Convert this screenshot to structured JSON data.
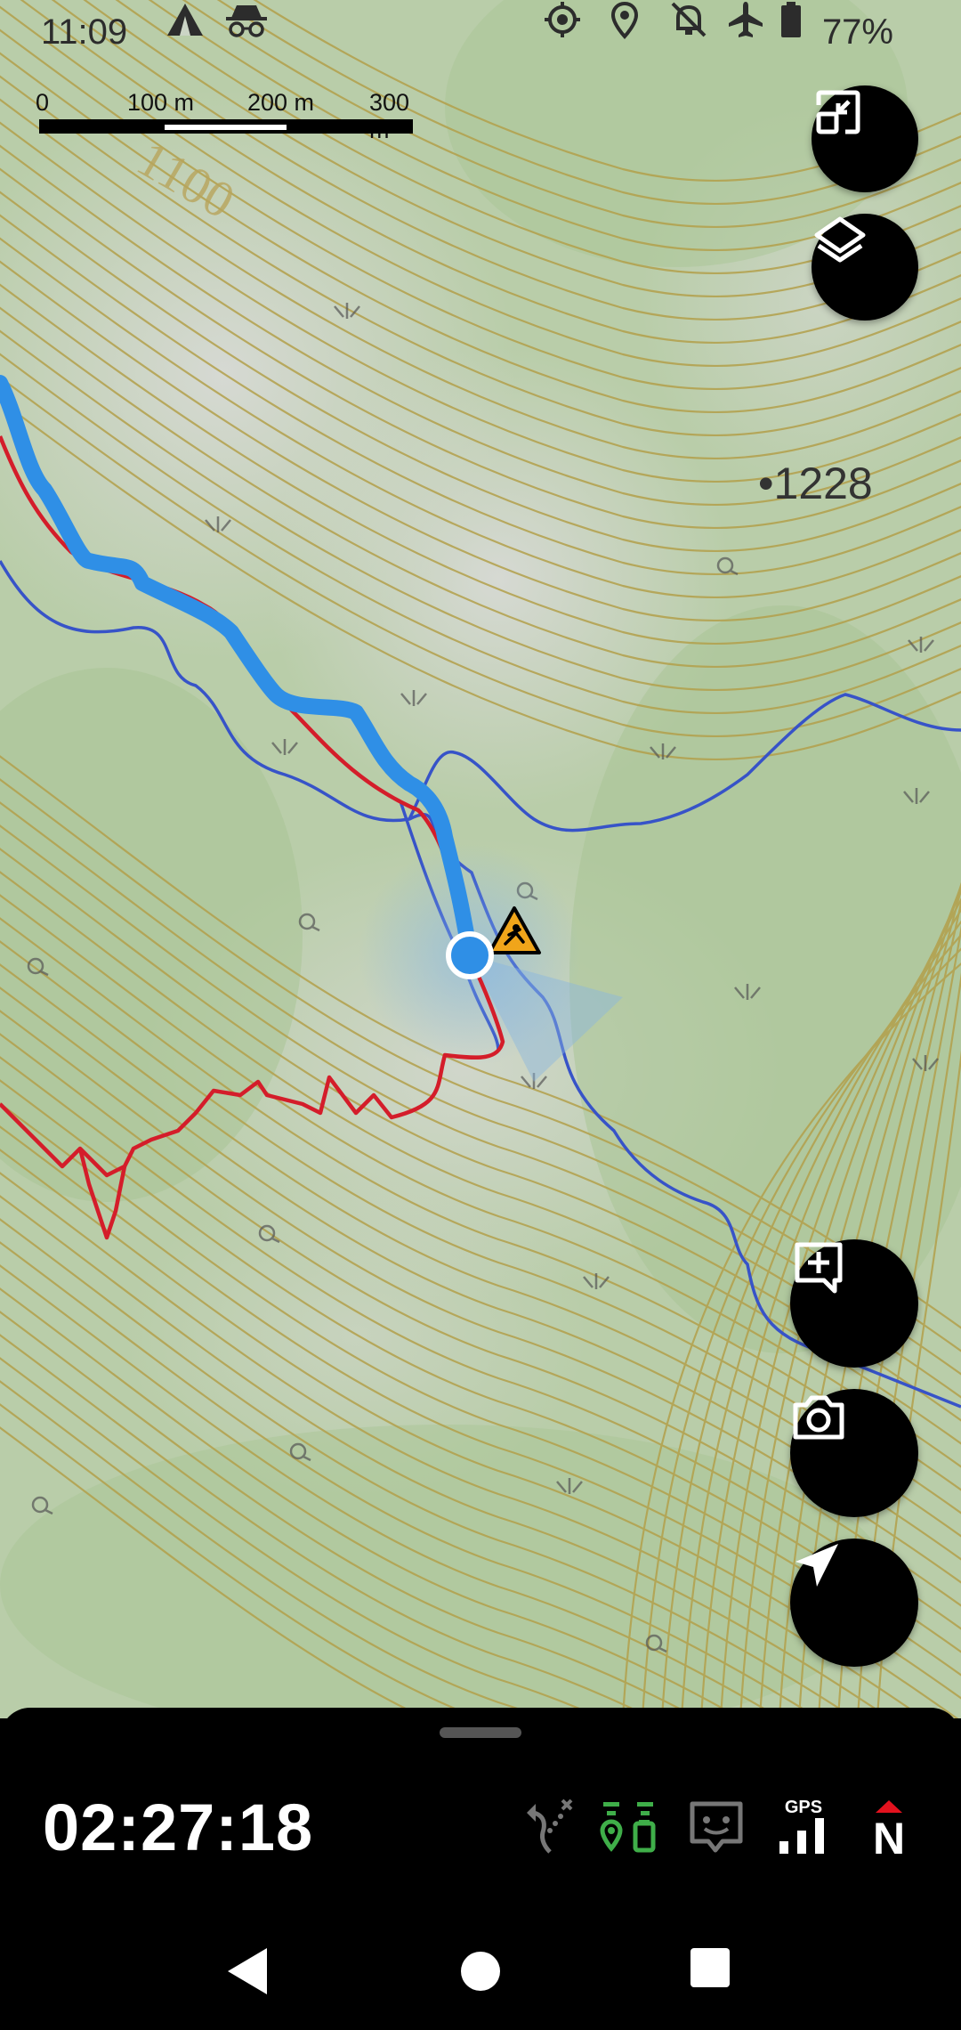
{
  "status_bar": {
    "time": "11:09",
    "battery": "77%",
    "icons": [
      "tent-icon",
      "incognito-icon",
      "gps-target-icon",
      "location-pin-icon",
      "notifications-off-icon",
      "airplane-mode-icon",
      "battery-icon"
    ]
  },
  "scale_bar": {
    "labels": [
      "0",
      "100 m",
      "200 m",
      "300 m"
    ]
  },
  "map": {
    "elevation_labels": [
      "1100",
      "•1228"
    ],
    "markers": [
      "current-location-dot",
      "fall-hazard-warning-icon"
    ],
    "colors": {
      "track": "#2f8fe6",
      "trail": "#d41d2a",
      "stream": "#3753c8",
      "contour": "#b3a04b",
      "terrain_light": "#cfd6c9",
      "terrain_green": "#a9c596"
    }
  },
  "fabs": [
    "fit-screen-icon",
    "layers-icon",
    "add-note-icon",
    "camera-icon",
    "navigate-icon"
  ],
  "bottom_panel": {
    "timer": "02:27:18",
    "gps_label": "GPS",
    "compass_label": "N",
    "icons": [
      "route-off-icon",
      "track-recording-icon",
      "message-icon",
      "gps-signal-icon",
      "compass-north-icon"
    ],
    "accent": "#3fae49"
  },
  "nav_bar": [
    "back-icon",
    "home-icon",
    "recents-icon"
  ]
}
